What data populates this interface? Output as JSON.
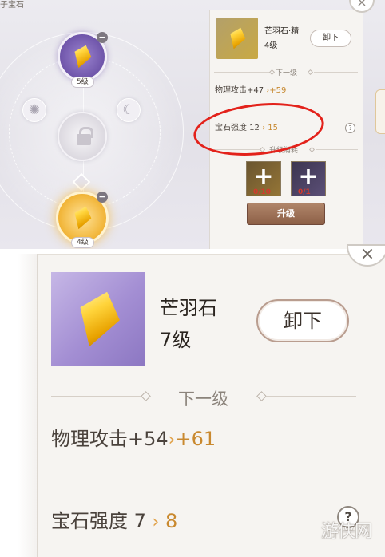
{
  "top": {
    "corner_text": "子宝石",
    "slot_levels": {
      "upper": "5级",
      "lower": "4级"
    },
    "panel": {
      "gem_name": "芒羽石·精",
      "gem_level": "4级",
      "unload_label": "卸下",
      "next_level_label": "下一级",
      "stat1": {
        "label": "物理攻击+47",
        "next": "+59"
      },
      "stat2": {
        "label": "宝石强度 12",
        "next": "15"
      },
      "help_label": "?",
      "upgrade_cost_label": "升级消耗",
      "materials": [
        {
          "count": "0/10"
        },
        {
          "count": "0/1"
        }
      ],
      "upgrade_label": "升级"
    },
    "close_label": "×"
  },
  "zoom": {
    "gem_name": "芒羽石",
    "gem_level": "7级",
    "unload_label": "卸下",
    "next_level_label": "下一级",
    "stat1": {
      "label": "物理攻击+54",
      "next": "+61"
    },
    "stat2": {
      "label": "宝石强度 7",
      "next": "8"
    },
    "help_label": "?",
    "close_label": "×"
  },
  "arrow_glyph": "›",
  "watermark": "游侠网",
  "colors": {
    "accent_gold": "#c88a33",
    "annotation_red": "#e3221b",
    "upgrade_button": "#8d6047"
  }
}
